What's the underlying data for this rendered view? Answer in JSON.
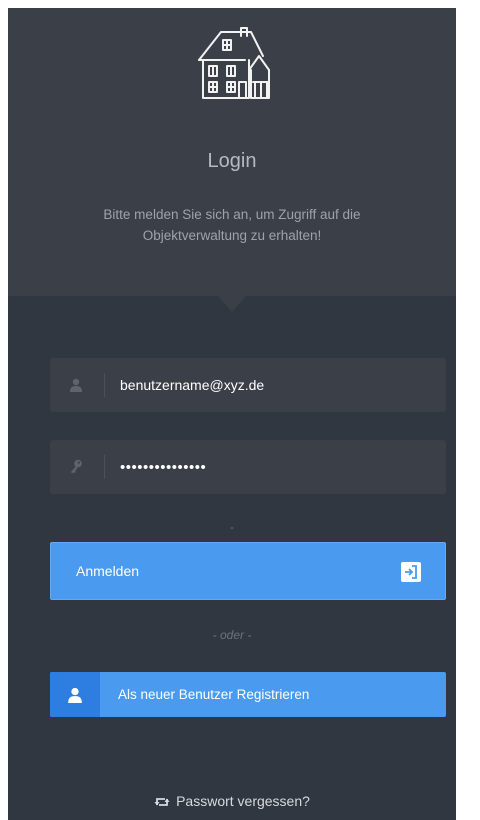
{
  "header": {
    "title": "Login",
    "subtitle": "Bitte melden Sie sich an, um Zugriff auf die Objektverwaltung zu erhalten!",
    "logo_icon": "house-sketch-icon"
  },
  "form": {
    "username": {
      "value": "benutzername@xyz.de",
      "icon": "user-icon"
    },
    "password": {
      "value": "•••••••••••••••",
      "icon": "key-icon"
    },
    "separator": "-"
  },
  "login_button": {
    "label": "Anmelden",
    "icon": "sign-in-icon"
  },
  "divider": {
    "label": "- oder -"
  },
  "register_button": {
    "label": "Als neuer Benutzer Registrieren",
    "icon": "user-icon"
  },
  "forgot_password": {
    "label": "Passwort vergessen?",
    "icon": "retweet-icon"
  },
  "colors": {
    "background": "#313740",
    "header": "#3a3f48",
    "accent": "#4a9bf0",
    "accent_dark": "#2e7de0"
  }
}
